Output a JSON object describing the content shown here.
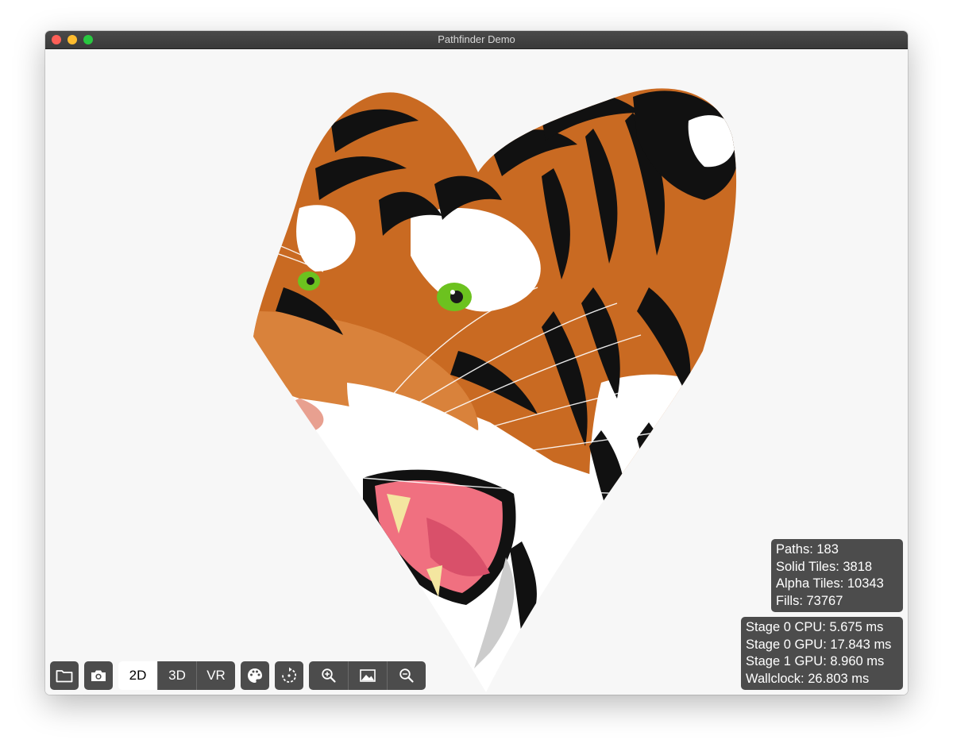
{
  "window": {
    "title": "Pathfinder Demo"
  },
  "toolbar": {
    "open_icon": "folder-icon",
    "screenshot_icon": "camera-icon",
    "mode_tabs": [
      {
        "label": "2D",
        "active": true
      },
      {
        "label": "3D",
        "active": false
      },
      {
        "label": "VR",
        "active": false
      }
    ],
    "background_icon": "palette-icon",
    "rotate_icon": "rotate-icon",
    "zoom_in_icon": "zoom-in-icon",
    "actual_size_icon": "image-icon",
    "zoom_out_icon": "zoom-out-icon"
  },
  "stats": {
    "scene": [
      "Paths: 183",
      "Solid Tiles: 3818",
      "Alpha Tiles: 10343",
      "Fills: 73767"
    ],
    "timing": [
      "Stage 0 CPU: 5.675 ms",
      "Stage 0 GPU: 17.843 ms",
      "Stage 1 GPU: 8.960 ms",
      "Wallclock: 26.803 ms"
    ]
  },
  "colors": {
    "panel": "#4c4c4c",
    "canvas": "#f7f7f7",
    "tiger_orange": "#c96a22",
    "eye_green": "#6cc21f",
    "mouth_pink": "#f07080"
  }
}
